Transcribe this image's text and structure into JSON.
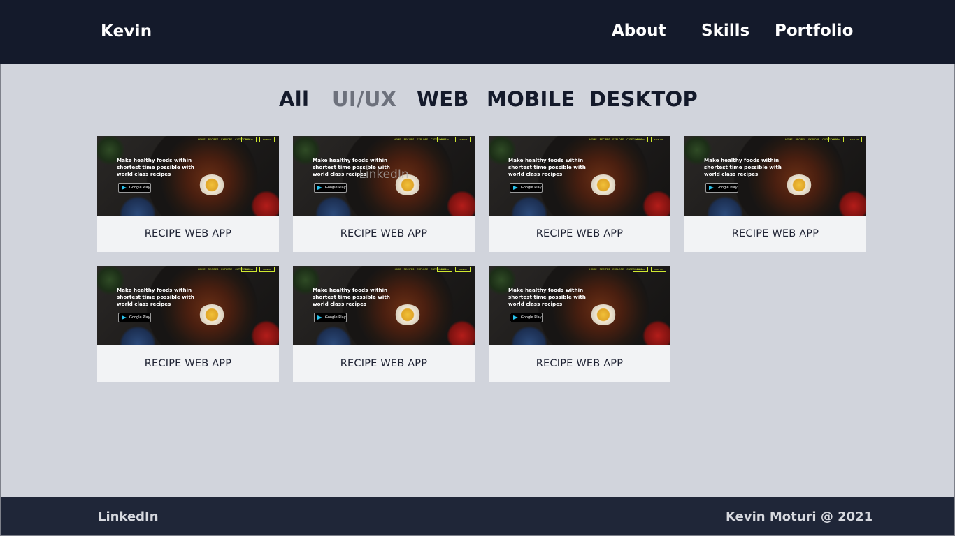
{
  "header": {
    "brand": "Kevin",
    "nav": [
      "About",
      "Skills",
      "Portfolio"
    ]
  },
  "filters": {
    "items": [
      "All",
      "UI/UX",
      "WEB",
      "MOBILE",
      "DESKTOP"
    ],
    "active": "UI/UX"
  },
  "thumbnail": {
    "headline": "Make healthy foods within shortest time possible with world class recipes",
    "store_badge": "Google Play",
    "nav_items": [
      "HOME",
      "RECIPES",
      "EXPLORE",
      "CATEGORIES"
    ],
    "buttons": [
      "SIGN IN",
      "SIGN UP"
    ]
  },
  "cards": [
    {
      "title": "RECIPE WEB APP",
      "overlay": ""
    },
    {
      "title": "RECIPE WEB APP",
      "overlay": "LinkedIn"
    },
    {
      "title": "RECIPE WEB APP",
      "overlay": ""
    },
    {
      "title": "RECIPE WEB APP",
      "overlay": ""
    },
    {
      "title": "RECIPE WEB APP",
      "overlay": ""
    },
    {
      "title": "RECIPE WEB APP",
      "overlay": ""
    },
    {
      "title": "RECIPE WEB APP",
      "overlay": ""
    }
  ],
  "footer": {
    "link": "LinkedIn",
    "copyright": "Kevin Moturi @ 2021"
  },
  "colors": {
    "header_bg": "#141a2b",
    "main_bg": "#d1d4dc",
    "footer_bg": "#1f2638",
    "active_filter": "#6d717c",
    "card_caption_bg": "#f2f3f5"
  }
}
